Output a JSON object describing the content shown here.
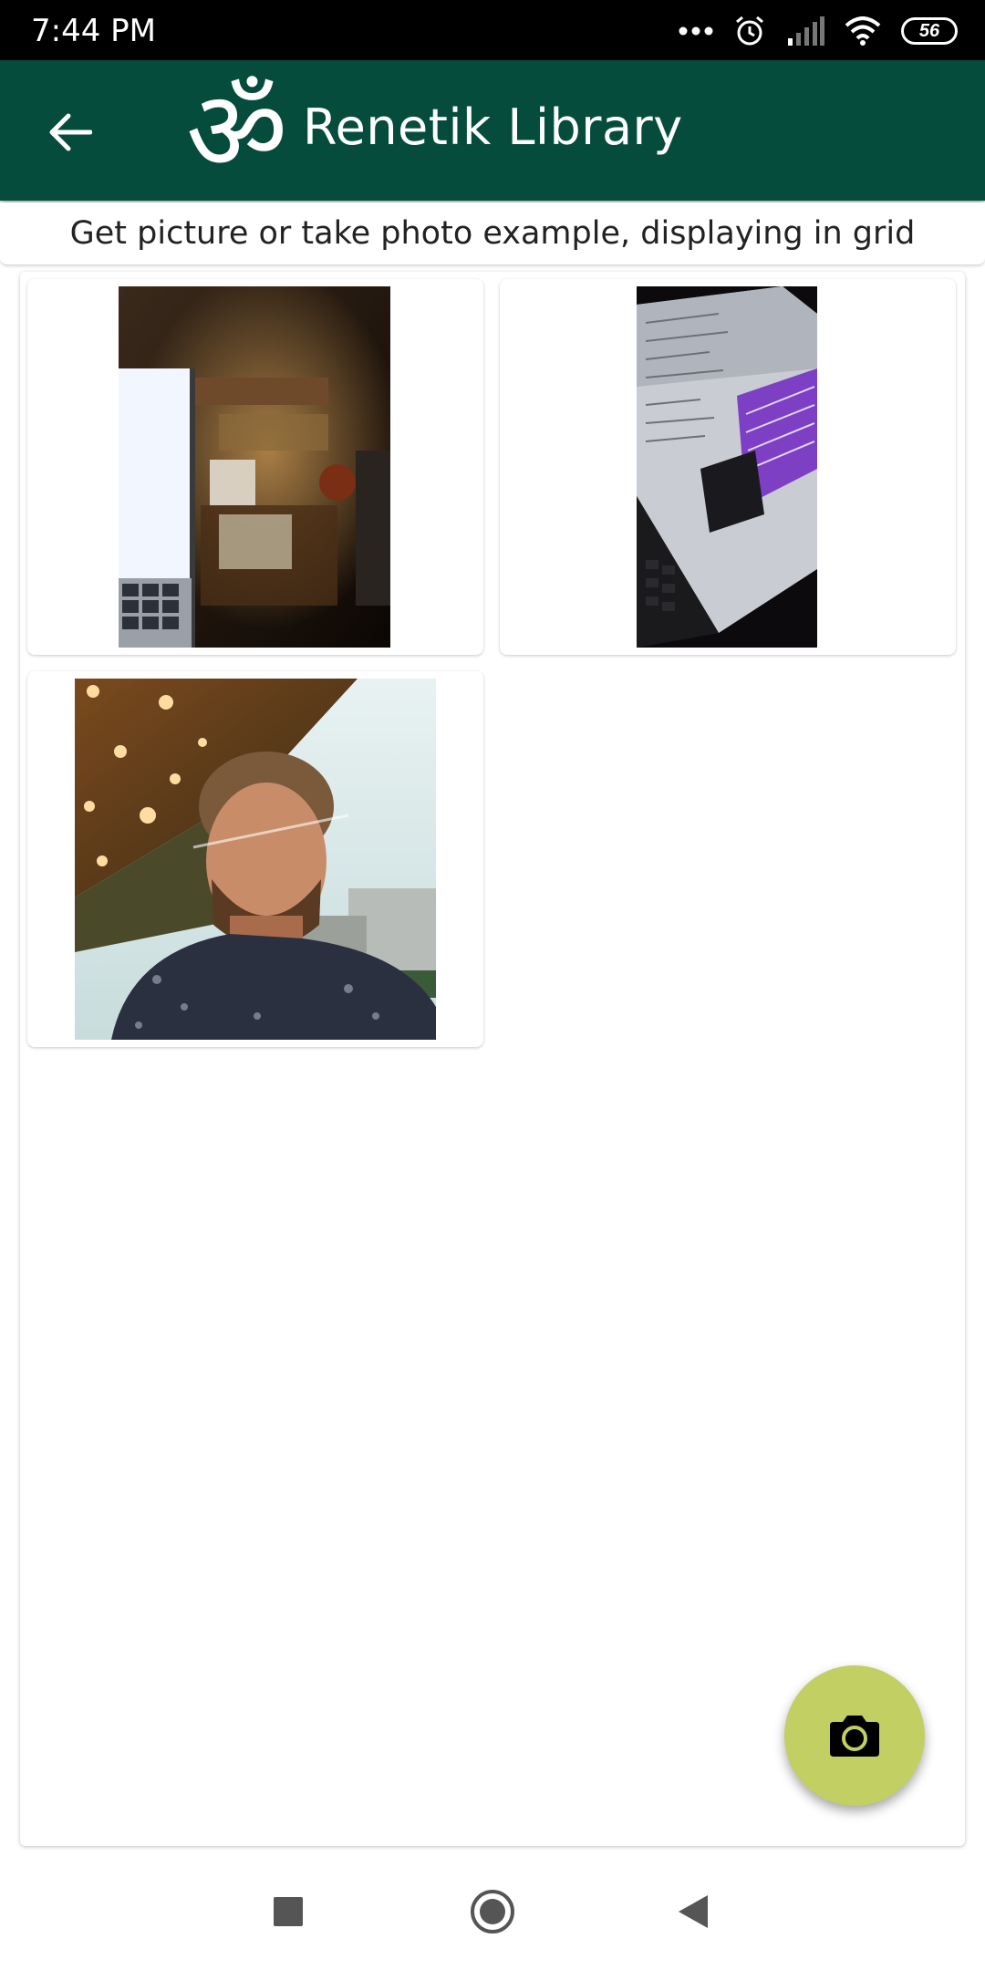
{
  "status_bar": {
    "time": "7:44 PM",
    "battery": "56",
    "icons": [
      "more-dots-icon",
      "alarm-icon",
      "signal-icon",
      "wifi-icon",
      "battery-icon"
    ]
  },
  "toolbar": {
    "title": "Renetik Library",
    "logo_glyph": "ॐ",
    "background": "#054c3c",
    "back_icon": "arrow-left-icon"
  },
  "header": {
    "subtitle": "Get picture or take photo example, displaying in grid"
  },
  "grid": {
    "items": [
      {
        "name": "laptop-desk-photo"
      },
      {
        "name": "laptop-screen-photo"
      },
      {
        "name": "man-selfie-photo"
      }
    ]
  },
  "fab": {
    "icon": "camera-icon",
    "color": "#c2cf63"
  },
  "nav_bar": {
    "buttons": [
      "recent-apps-icon",
      "home-icon",
      "back-icon"
    ]
  }
}
